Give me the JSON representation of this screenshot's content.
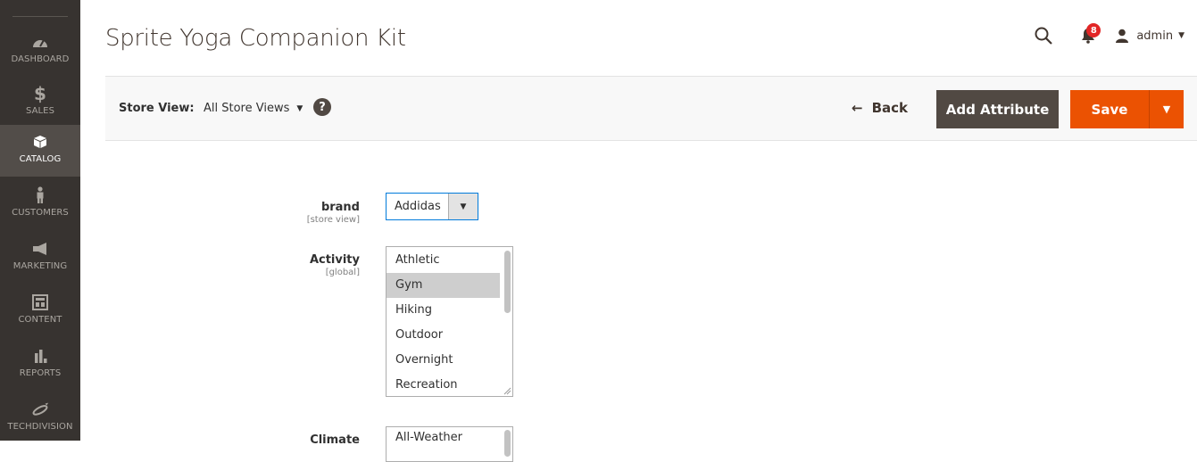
{
  "sidebar": {
    "items": [
      {
        "label": "DASHBOARD",
        "icon": "dashboard-icon"
      },
      {
        "label": "SALES",
        "icon": "dollar-icon"
      },
      {
        "label": "CATALOG",
        "icon": "box-icon",
        "active": true
      },
      {
        "label": "CUSTOMERS",
        "icon": "person-icon"
      },
      {
        "label": "MARKETING",
        "icon": "megaphone-icon"
      },
      {
        "label": "CONTENT",
        "icon": "layout-icon"
      },
      {
        "label": "REPORTS",
        "icon": "bar-chart-icon"
      },
      {
        "label": "TECHDIVISION",
        "icon": "techdivision-icon"
      }
    ]
  },
  "header": {
    "title": "Sprite Yoga Companion Kit",
    "notifications_count": "8",
    "user_name": "admin"
  },
  "toolbar": {
    "store_view_label": "Store View:",
    "store_view_value": "All Store Views",
    "help_label": "?",
    "back_label": "Back",
    "add_attribute_label": "Add Attribute",
    "save_label": "Save"
  },
  "form": {
    "brand": {
      "label": "brand",
      "scope": "[store view]",
      "value": "Addidas"
    },
    "activity": {
      "label": "Activity",
      "scope": "[global]",
      "options": [
        "Athletic",
        "Gym",
        "Hiking",
        "Outdoor",
        "Overnight",
        "Recreation"
      ],
      "selected": "Gym"
    },
    "climate": {
      "label": "Climate",
      "options": [
        "All-Weather"
      ]
    }
  },
  "colors": {
    "sidebar_bg": "#373330",
    "sidebar_active": "#524d49",
    "primary_button": "#eb5202",
    "secondary_button": "#514943",
    "focus_border": "#007bdb"
  }
}
